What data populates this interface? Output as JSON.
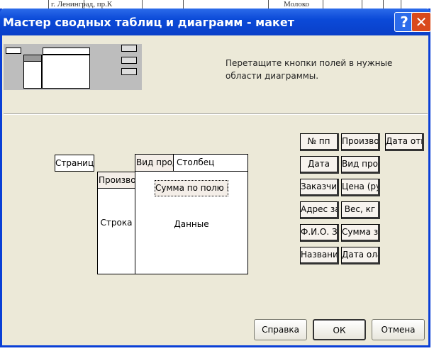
{
  "background": {
    "cell1": "г. Ленинград, пр.К",
    "cell2": "Молоко"
  },
  "dialog": {
    "title": "Мастер сводных таблиц и диаграмм - макет",
    "help_label": "?",
    "close_label": "✕",
    "instruction_line1": "Перетащите кнопки полей в нужные",
    "instruction_line2": "области диаграммы."
  },
  "layout": {
    "page_area": "Страница",
    "row_area": "Строка",
    "column_area": "Столбец",
    "data_area": "Данные",
    "row_field": "Производ",
    "column_field": "Вид проду",
    "data_field": "Сумма по полю Вес"
  },
  "fields": [
    [
      "№ пп",
      "Производ",
      "Дата отпр"
    ],
    [
      "Дата",
      "Вид проду"
    ],
    [
      "Заказчик",
      "Цена (руб"
    ],
    [
      "Адрес зак",
      "Вес, кг"
    ],
    [
      "Ф.И.О. За",
      "Сумма за"
    ],
    [
      "Название",
      "Дата олат"
    ]
  ],
  "buttons": {
    "help": "Справка",
    "ok": "ОК",
    "cancel": "Отмена"
  }
}
